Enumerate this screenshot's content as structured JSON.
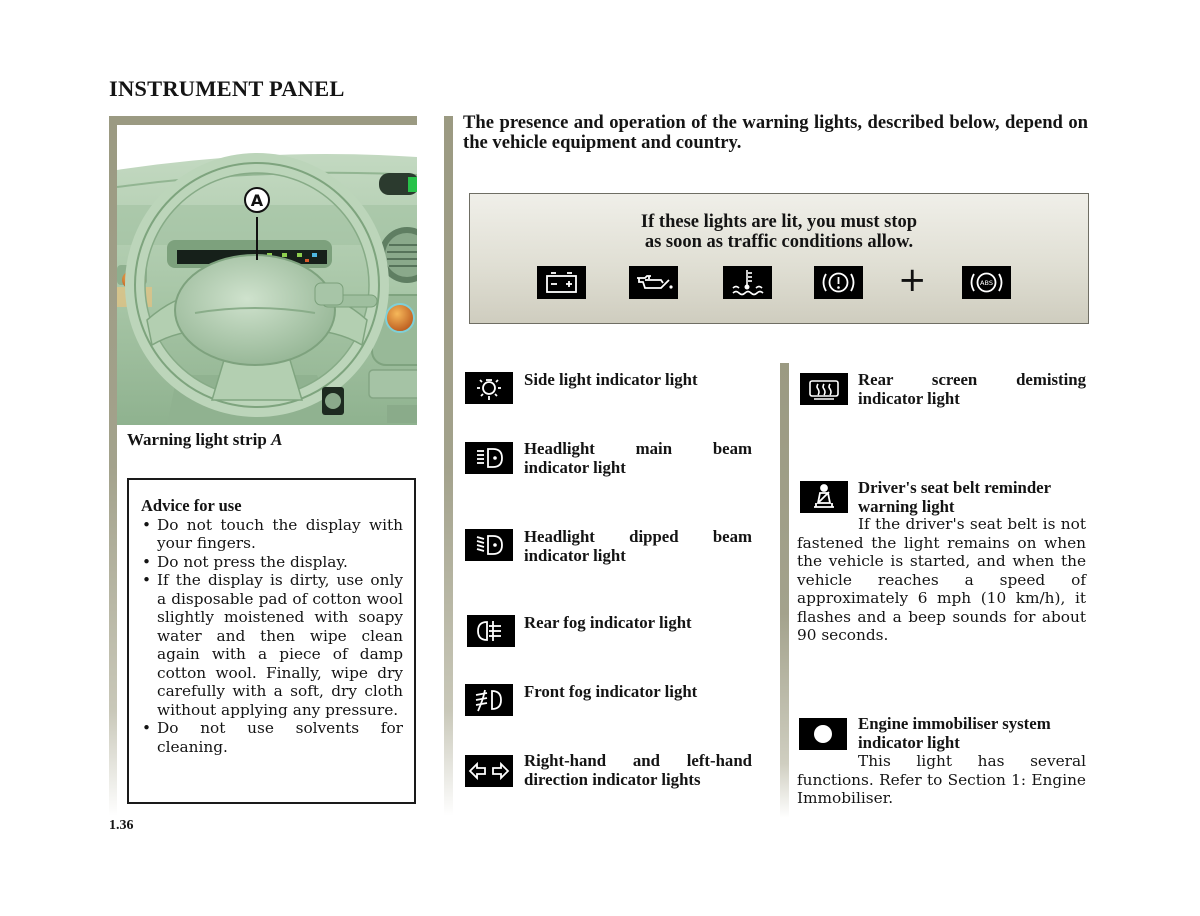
{
  "page": {
    "title": "INSTRUMENT PANEL",
    "page_number": "1.36"
  },
  "figure": {
    "callout_label": "A",
    "caption_text": "Warning light strip ",
    "caption_ref": "A",
    "colors": {
      "frame": "#9b9a82",
      "dashboard": "#a9c7a8"
    }
  },
  "advice": {
    "title": "Advice for use",
    "items": [
      "Do not touch the display with your fingers.",
      "Do not press the display.",
      "If the display is dirty, use only a disposable pad of cotton wool slightly moistened with soapy water and then wipe clean again with a piece of damp cotton wool. Finally, wipe dry carefully with a soft, dry cloth without applying any pressure.",
      "Do not use solvents for cleaning."
    ]
  },
  "intro": {
    "text": "The presence and operation of the warning lights, described below, depend on the vehicle equipment and country."
  },
  "stop_box": {
    "line1": "If these lights are lit, you must stop",
    "line2": "as soon as traffic conditions allow.",
    "icons": [
      "battery-icon",
      "oil-pressure-icon",
      "coolant-temperature-icon",
      "brake-warning-icon",
      "abs-icon"
    ],
    "plus_symbol": "+"
  },
  "indicators_left": [
    {
      "icon": "side-light-icon",
      "title": "Side light indicator light"
    },
    {
      "icon": "main-beam-icon",
      "title_line1": "Headlight main beam",
      "title_line2": "indicator light"
    },
    {
      "icon": "dipped-beam-icon",
      "title_line1": "Headlight dipped beam",
      "title_line2": "indicator light"
    },
    {
      "icon": "rear-fog-icon",
      "title": "Rear fog indicator light"
    },
    {
      "icon": "front-fog-icon",
      "title": "Front fog indicator light"
    },
    {
      "icon": "direction-indicator-icon",
      "title_line1": "Right-hand and left-hand",
      "title_line2": "direction indicator lights"
    }
  ],
  "indicators_right": [
    {
      "icon": "rear-screen-demist-icon",
      "title_line1": "Rear screen demisting",
      "title_line2": "indicator light"
    },
    {
      "icon": "seat-belt-icon",
      "title_line1": "Driver's seat belt reminder",
      "title_line2": "warning light",
      "body_first": "If the driver's seat belt is not",
      "body_rest": "fastened the light remains on when the vehicle is started, and when the vehicle reaches a speed of approximately 6 mph (10 km/h), it flashes and a beep sounds for about 90 seconds."
    },
    {
      "icon": "immobiliser-icon",
      "title_line1": "Engine immobiliser system",
      "title_line2": "indicator light",
      "body_first": "This light has several",
      "body_rest": "functions. Refer to Section 1: Engine Immobiliser."
    }
  ]
}
